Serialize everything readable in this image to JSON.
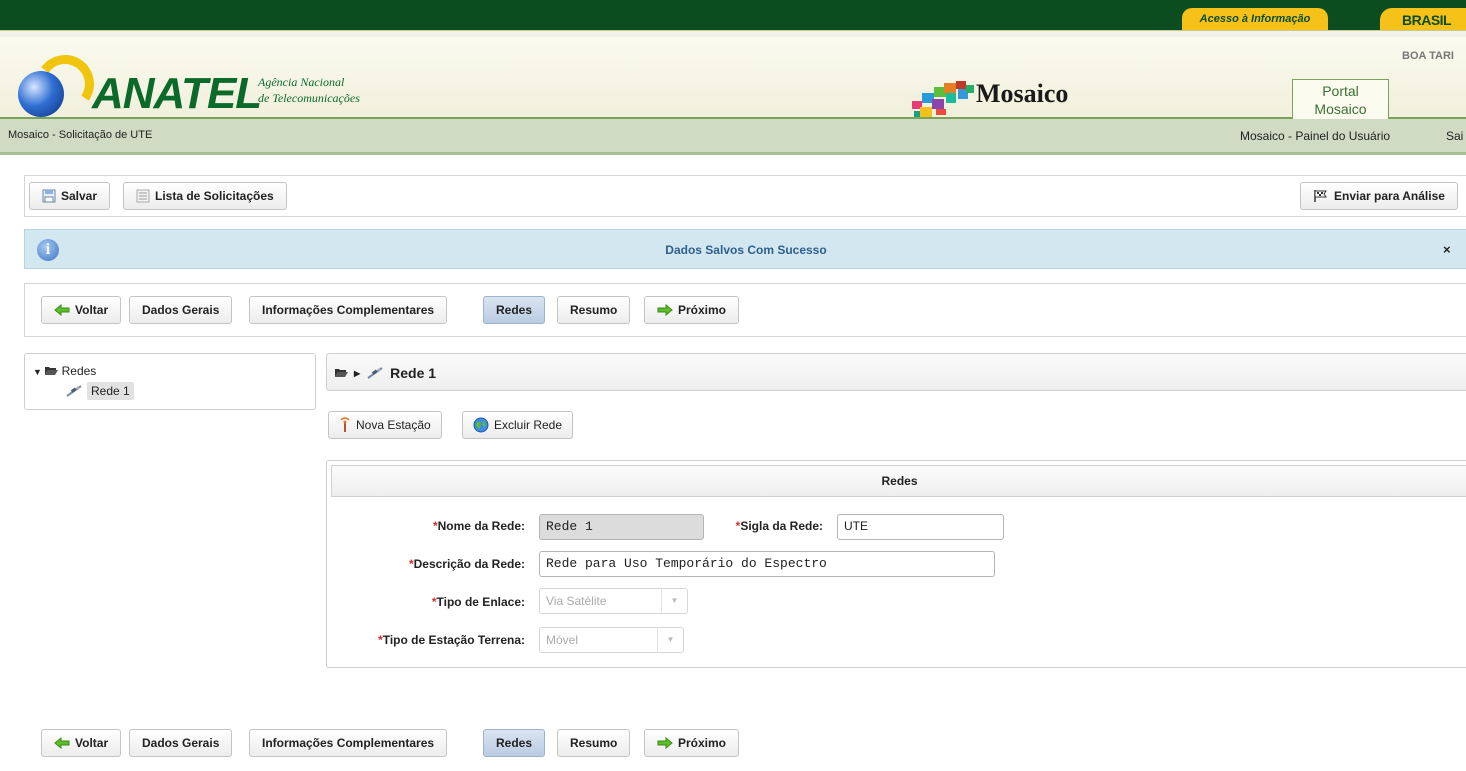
{
  "gov": {
    "acesso": "Acesso à Informação",
    "brasil": "BRASIL",
    "greeting": "BOA TARI"
  },
  "header": {
    "logo": "ANATEL",
    "logo_sub_1": "Agência Nacional",
    "logo_sub_2": "de Telecomunicações",
    "app_title": "Mosaico",
    "portal_tab_1": "Portal",
    "portal_tab_2": "Mosaico"
  },
  "breadcrumb": {
    "current": "Mosaico - Solicitação de UTE",
    "user_panel": "Mosaico - Painel do Usuário",
    "exit": "Sai"
  },
  "toolbar": {
    "save": "Salvar",
    "list": "Lista de Solicitações",
    "send": "Enviar para Análise"
  },
  "message": {
    "text": "Dados Salvos Com Sucesso",
    "close": "×"
  },
  "steps": {
    "back": "Voltar",
    "general": "Dados Gerais",
    "complementary": "Informações Complementares",
    "networks": "Redes",
    "summary": "Resumo",
    "next": "Próximo",
    "active": "Redes"
  },
  "tree": {
    "root": "Redes",
    "child": "Rede 1"
  },
  "panel": {
    "title": "Rede 1"
  },
  "actions": {
    "new_station": "Nova Estação",
    "delete_network": "Excluir Rede"
  },
  "form": {
    "title": "Redes",
    "name_label": "Nome da Rede:",
    "name_value": "Rede 1",
    "acronym_label": "Sigla da Rede:",
    "acronym_value": "UTE",
    "description_label": "Descrição da Rede:",
    "description_value": "Rede para Uso Temporário do Espectro",
    "link_type_label": "Tipo de Enlace:",
    "link_type_value": "Via Satélite",
    "station_type_label": "Tipo de Estação Terrena:",
    "station_type_value": "Móvel",
    "required_mark": "*"
  },
  "colors": {
    "gov_green": "#0b4d1f",
    "brand_green": "#0b6a2a",
    "info_bg": "#d3e7f1",
    "active_step": "#b9cbe2",
    "required": "#d62c2c"
  }
}
